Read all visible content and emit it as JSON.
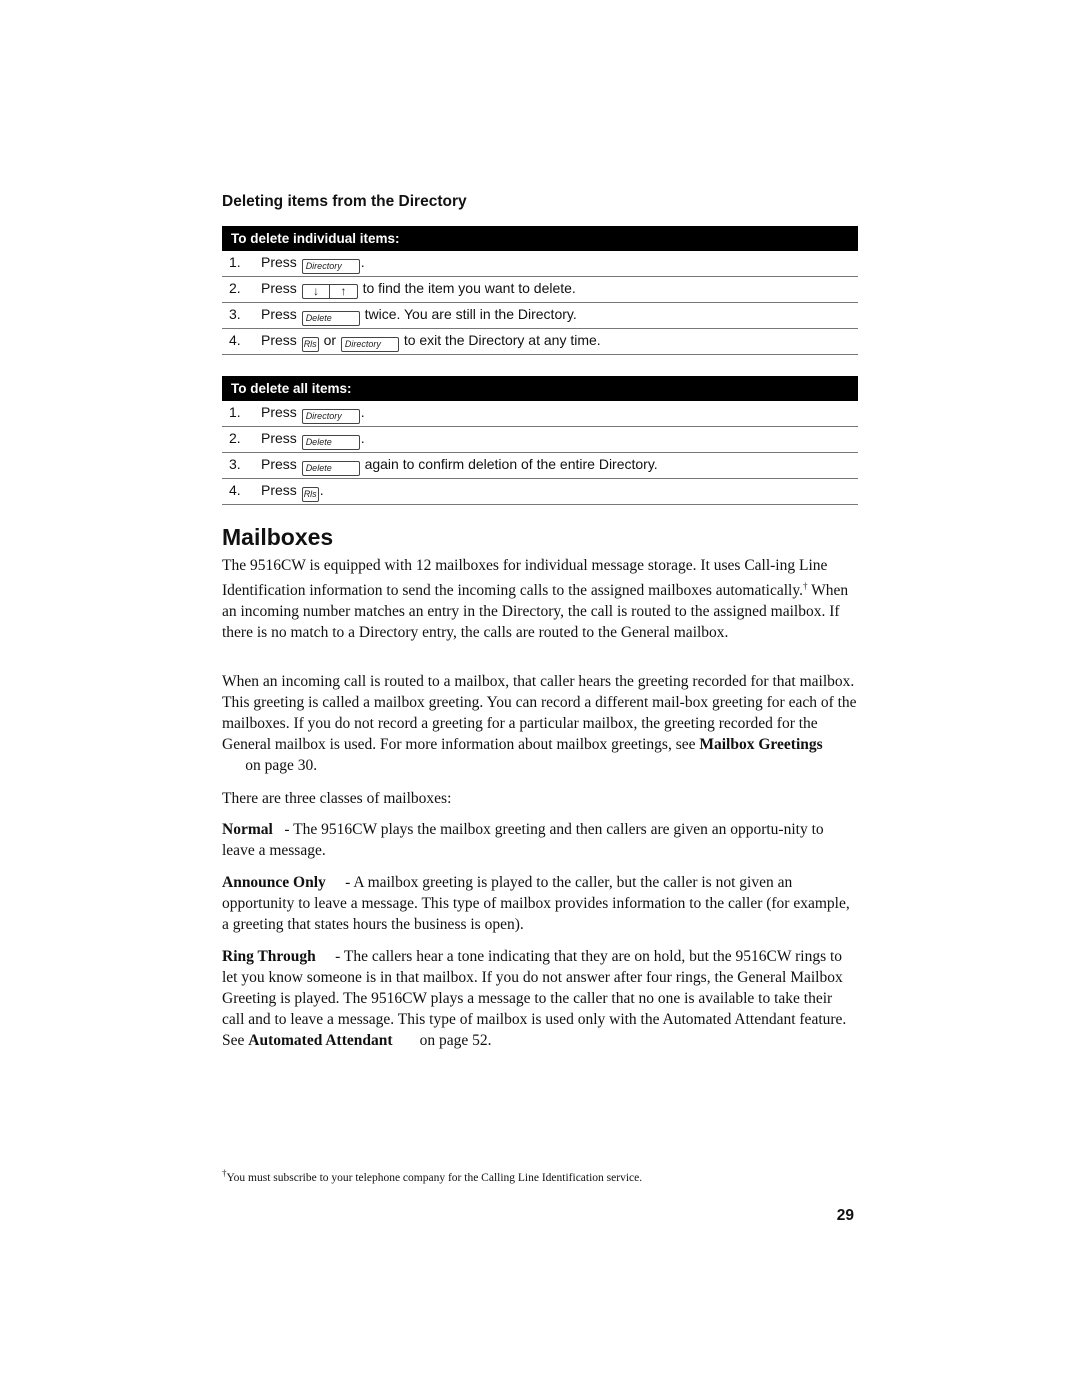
{
  "section": {
    "title": "Deleting items from the Directory",
    "procedures": [
      {
        "header": "To delete individual items:",
        "steps": [
          {
            "num": "1.",
            "press": "Press",
            "key1": "Directory",
            "text": "."
          },
          {
            "num": "2.",
            "press": "Press",
            "key_down": "↓",
            "key_up": "↑",
            "text": "to find the item you want to delete."
          },
          {
            "num": "3.",
            "press": "Press",
            "key1": "Delete",
            "text": "twice. You are still in the Directory."
          },
          {
            "num": "4.",
            "press": "Press",
            "key1": "Rls",
            "or": "or",
            "key2": "Directory",
            "text": "to exit the Directory at any time."
          }
        ]
      },
      {
        "header": "To delete all items:",
        "steps": [
          {
            "num": "1.",
            "press": "Press",
            "key1": "Directory",
            "text": "."
          },
          {
            "num": "2.",
            "press": "Press",
            "key1": "Delete",
            "text": "."
          },
          {
            "num": "3.",
            "press": "Press",
            "key1": "Delete",
            "text": "again to confirm deletion of the entire Directory."
          },
          {
            "num": "4.",
            "press": "Press",
            "key1": "Rls",
            "text": "."
          }
        ]
      }
    ]
  },
  "mailboxes": {
    "title": "Mailboxes",
    "p1_a": "The 9516CW is equipped with 12 mailboxes for individual message storage. It uses Call-ing Line Identification information to send the incoming calls to the assigned mailboxes automatically.",
    "p1_dagger": "†",
    "p1_b": " When an incoming number matches an entry in the Directory, the call is routed to the assigned mailbox. If there is no match to a Directory entry, the calls are routed to the General mailbox.",
    "p2_a": "When an incoming call is routed to a mailbox, that caller hears the greeting recorded for that mailbox. This greeting is called a mailbox greeting. You can record a different mail-box greeting for each of the mailboxes. If you do not record a greeting for a particular mailbox, the greeting recorded for the General mailbox is used. For more information about mailbox greetings, see ",
    "p2_link": "Mailbox Greetings",
    "p2_b": "      on page 30.",
    "p3": "There are three classes of mailboxes:",
    "classes": [
      {
        "name": "Normal",
        "desc": "   - The 9516CW plays the mailbox greeting and then callers are given an opportu-nity to leave a message."
      },
      {
        "name": "Announce Only",
        "desc": "     - A mailbox greeting is played to the caller, but the caller is not given an opportunity to leave a message. This type of mailbox provides information to the caller (for example, a greeting that states hours the business is open)."
      },
      {
        "name": "Ring Through",
        "desc": "     - The callers hear a tone indicating that they are on hold, but the 9516CW rings to let you know someone is in that mailbox. If you do not answer after four rings, the General Mailbox Greeting is played. The 9516CW plays a message to the caller that no one is available to take their call and to leave a message. This type of mailbox is used only with the Automated Attendant feature. See ",
        "link": "Automated Attendant",
        "after": "       on page 52."
      }
    ]
  },
  "footnote": {
    "dagger": "†",
    "text": "You must subscribe to your telephone company for the Calling Line Identification service."
  },
  "page_number": "29"
}
